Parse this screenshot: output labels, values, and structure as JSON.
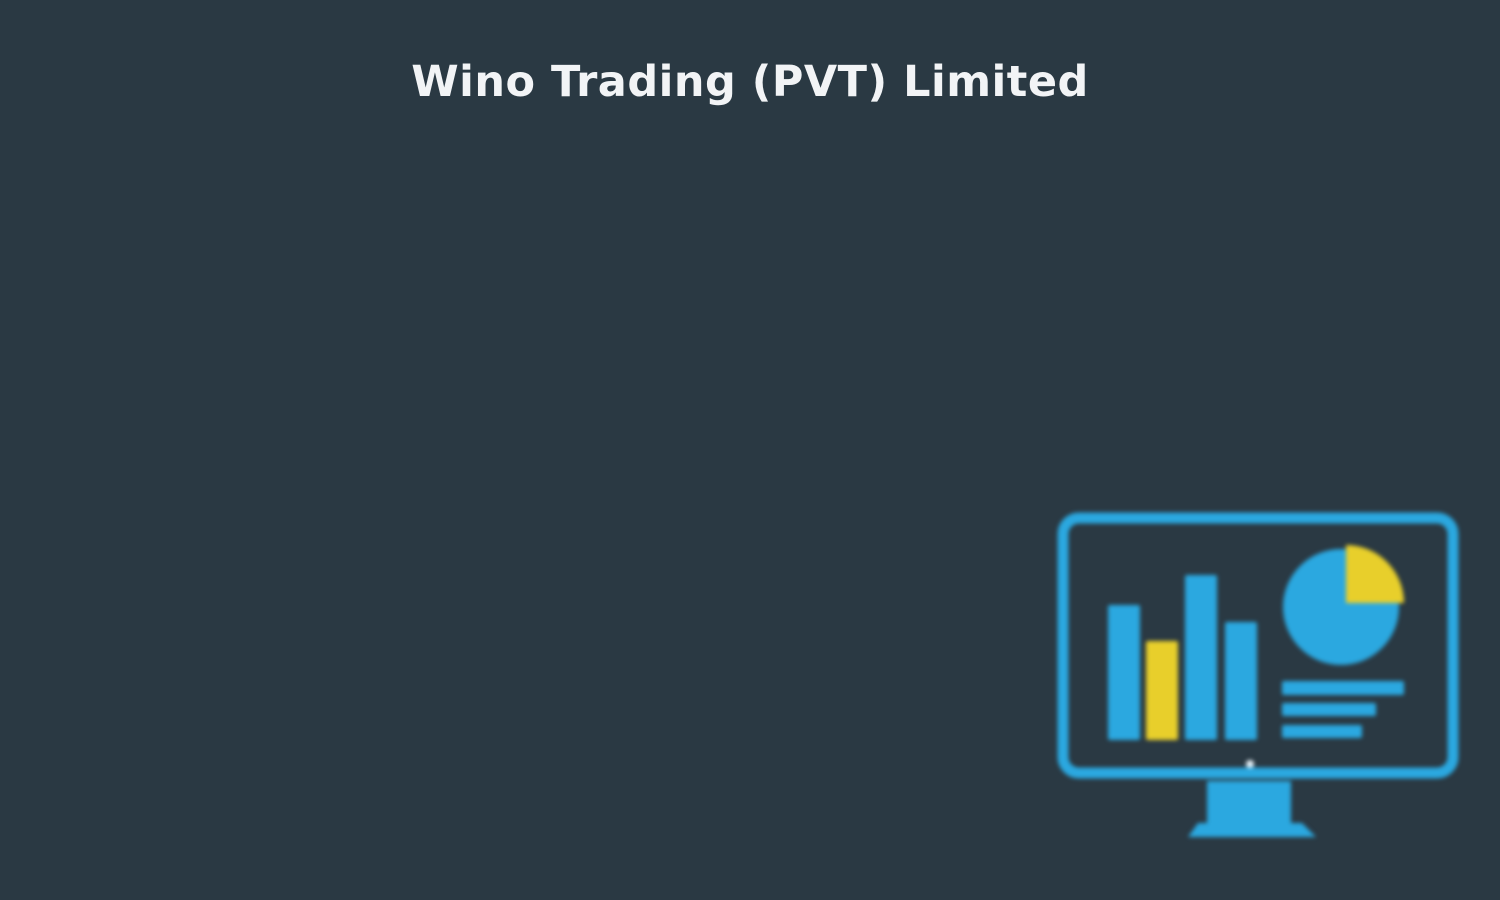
{
  "header": {
    "title": "Wino Trading (PVT) Limited"
  },
  "illustration": {
    "icon": "monitor-dashboard-icon"
  },
  "colors": {
    "background": "#2a3943",
    "title_text": "#f2f4f6",
    "accent_blue": "#2ba8e0",
    "accent_yellow": "#e8cf2b"
  }
}
